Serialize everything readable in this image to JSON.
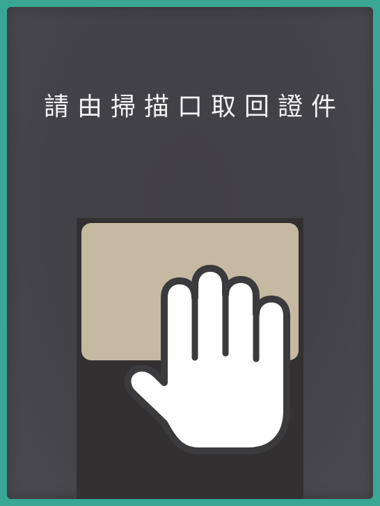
{
  "instruction": {
    "text": "請由掃描口取回證件"
  },
  "colors": {
    "frame": "#3aa795",
    "screen_background": "#434246",
    "scanner_body": "#323031",
    "scan_window": "#c5b9a2",
    "hand_fill": "#ffffff",
    "hand_outline": "#3b3a3d"
  },
  "icons": {
    "hand": "hand-icon"
  }
}
